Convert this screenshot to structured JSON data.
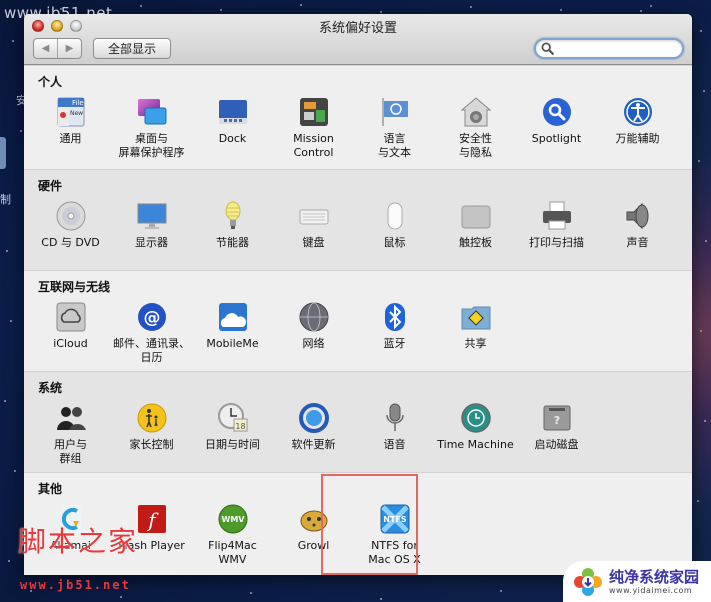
{
  "window": {
    "title": "系统偏好设置",
    "toolbar": {
      "back_label": "◀",
      "forward_label": "▶",
      "show_all_label": "全部显示",
      "search_value": "",
      "search_placeholder": ""
    }
  },
  "sections": [
    {
      "title": "个人",
      "items": [
        {
          "label": "通用",
          "icon": "general-icon"
        },
        {
          "label": "桌面与\n屏幕保护程序",
          "icon": "desktop-screensaver-icon"
        },
        {
          "label": "Dock",
          "icon": "dock-icon"
        },
        {
          "label": "Mission\nControl",
          "icon": "mission-control-icon"
        },
        {
          "label": "语言\n与文本",
          "icon": "language-text-icon"
        },
        {
          "label": "安全性\n与隐私",
          "icon": "security-privacy-icon"
        },
        {
          "label": "Spotlight",
          "icon": "spotlight-icon"
        },
        {
          "label": "万能辅助",
          "icon": "universal-access-icon"
        }
      ]
    },
    {
      "title": "硬件",
      "items": [
        {
          "label": "CD 与 DVD",
          "icon": "cd-dvd-icon"
        },
        {
          "label": "显示器",
          "icon": "displays-icon"
        },
        {
          "label": "节能器",
          "icon": "energy-saver-icon"
        },
        {
          "label": "键盘",
          "icon": "keyboard-icon"
        },
        {
          "label": "鼠标",
          "icon": "mouse-icon"
        },
        {
          "label": "触控板",
          "icon": "trackpad-icon"
        },
        {
          "label": "打印与扫描",
          "icon": "print-scan-icon"
        },
        {
          "label": "声音",
          "icon": "sound-icon"
        }
      ]
    },
    {
      "title": "互联网与无线",
      "items": [
        {
          "label": "iCloud",
          "icon": "icloud-icon"
        },
        {
          "label": "邮件、通讯录、\n日历",
          "icon": "mail-contacts-calendars-icon"
        },
        {
          "label": "MobileMe",
          "icon": "mobileme-icon"
        },
        {
          "label": "网络",
          "icon": "network-icon"
        },
        {
          "label": "蓝牙",
          "icon": "bluetooth-icon"
        },
        {
          "label": "共享",
          "icon": "sharing-icon"
        }
      ]
    },
    {
      "title": "系统",
      "items": [
        {
          "label": "用户与\n群组",
          "icon": "users-groups-icon"
        },
        {
          "label": "家长控制",
          "icon": "parental-controls-icon"
        },
        {
          "label": "日期与时间",
          "icon": "date-time-icon",
          "badge": "18"
        },
        {
          "label": "软件更新",
          "icon": "software-update-icon"
        },
        {
          "label": "语音",
          "icon": "speech-icon"
        },
        {
          "label": "Time Machine",
          "icon": "time-machine-icon"
        },
        {
          "label": "启动磁盘",
          "icon": "startup-disk-icon"
        }
      ]
    },
    {
      "title": "其他",
      "items": [
        {
          "label": "Akamai",
          "icon": "akamai-icon"
        },
        {
          "label": "Flash Player",
          "icon": "flash-player-icon"
        },
        {
          "label": "Flip4Mac\nWMV",
          "icon": "flip4mac-icon",
          "badge": "WMV"
        },
        {
          "label": "Growl",
          "icon": "growl-icon"
        },
        {
          "label": "NTFS for\nMac OS X",
          "icon": "ntfs-icon",
          "badge": "NTFS",
          "highlighted": true
        }
      ]
    }
  ],
  "desktop": {
    "left_text_1": "安",
    "left_text_2": "制"
  },
  "watermarks": {
    "top_left": "www.jb51.net",
    "jb51_cn": "脚本之家",
    "jb51_url": "www.jb51.net",
    "yida_cn": "纯净系统家园",
    "yida_url": "www.yidaimei.com"
  },
  "colors": {
    "highlight_border": "#e06a63",
    "search_ring": "#7fa4cf"
  }
}
